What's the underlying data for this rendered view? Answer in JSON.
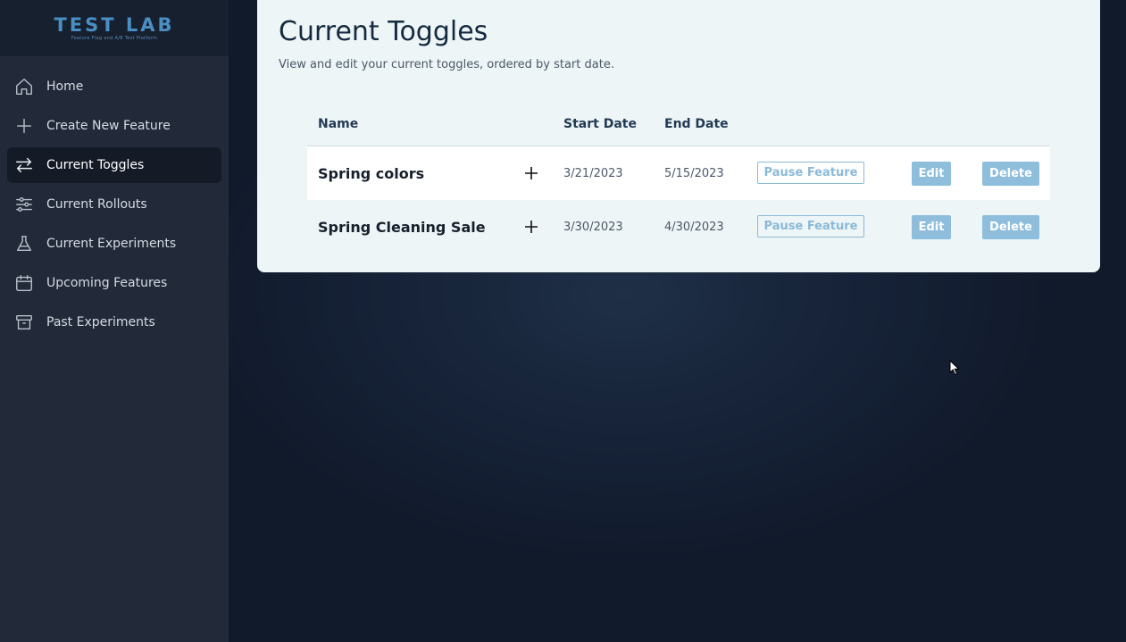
{
  "brand": {
    "title": "TEST LAB",
    "subtitle": "Feature Flag and A/B Test Platform"
  },
  "sidebar": {
    "items": [
      {
        "label": "Home",
        "icon": "home-icon",
        "active": false
      },
      {
        "label": "Create New Feature",
        "icon": "plus-icon",
        "active": false
      },
      {
        "label": "Current Toggles",
        "icon": "arrows-swap-icon",
        "active": true
      },
      {
        "label": "Current Rollouts",
        "icon": "sliders-icon",
        "active": false
      },
      {
        "label": "Current Experiments",
        "icon": "flask-icon",
        "active": false
      },
      {
        "label": "Upcoming Features",
        "icon": "calendar-icon",
        "active": false
      },
      {
        "label": "Past Experiments",
        "icon": "archive-icon",
        "active": false
      }
    ]
  },
  "main": {
    "title": "Current Toggles",
    "subtitle": "View and edit your current toggles, ordered by start date.",
    "table": {
      "headers": {
        "name": "Name",
        "start": "Start Date",
        "end": "End Date"
      },
      "rows": [
        {
          "name": "Spring colors",
          "start": "3/21/2023",
          "end": "5/15/2023"
        },
        {
          "name": "Spring Cleaning Sale",
          "start": "3/30/2023",
          "end": "4/30/2023"
        }
      ],
      "actions": {
        "pause": "Pause Feature",
        "edit": "Edit",
        "delete": "Delete"
      }
    }
  },
  "colors": {
    "accent": "#8ebedb",
    "sidebar_bg": "#222a39",
    "card_bg": "#edf5f6",
    "brand": "#4a8fc4"
  }
}
